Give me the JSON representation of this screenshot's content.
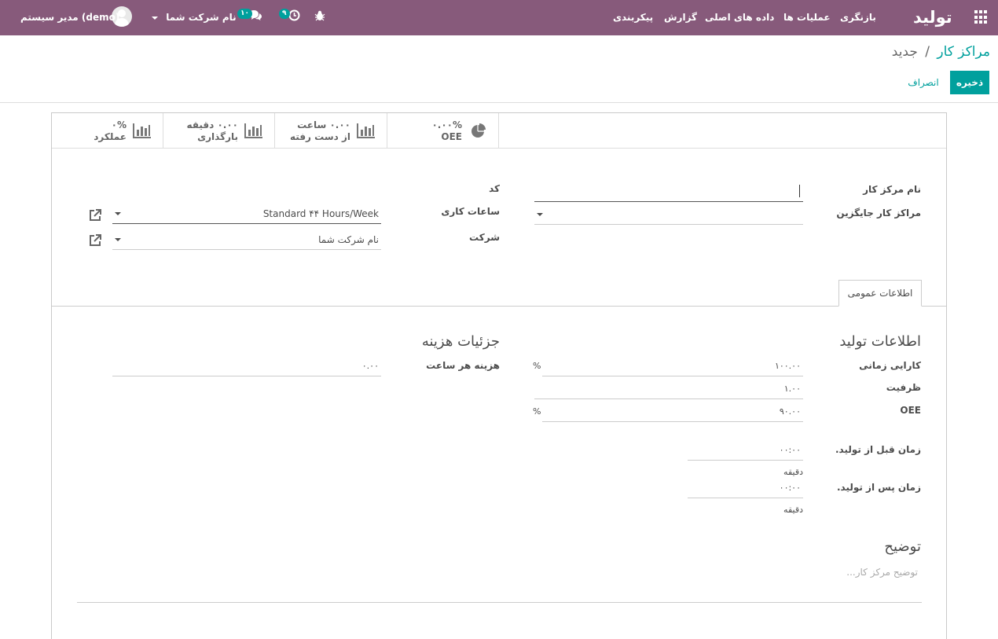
{
  "navbar": {
    "app_name": "تولید",
    "menus": [
      "بازنگری",
      "عملیات ها",
      "داده های اصلی",
      "گزارش",
      "پیکربندی"
    ],
    "user": "مدیر سیستم (demo)",
    "company": "نام شرکت شما",
    "messages_count": "۱۰",
    "activities_count": "۹"
  },
  "breadcrumb": {
    "parent": "مراکز کار",
    "separator": "/",
    "current": "جدید"
  },
  "buttons": {
    "save": "ذخیره",
    "discard": "انصراف"
  },
  "stat_buttons": [
    {
      "value": "۰.۰۰%",
      "label": "OEE",
      "icon": "pie-chart-icon"
    },
    {
      "value": "۰.۰۰ ساعت",
      "label": "از دست رفته",
      "icon": "bar-chart-icon"
    },
    {
      "value": "۰.۰۰ دقیقه",
      "label": "بارگذاری",
      "icon": "bar-chart-icon"
    },
    {
      "value": "۰%",
      "label": "عملکرد",
      "icon": "bar-chart-icon"
    }
  ],
  "form": {
    "name_label": "نام مرکز کار",
    "name_value": "",
    "alternative_label": "مراکز کار جایگزین",
    "alternative_value": "",
    "code_label": "کد",
    "working_hours_label": "ساعات کاری",
    "working_hours_value": "Standard ۴۴ Hours/Week",
    "company_label": "شرکت",
    "company_value": "نام شرکت شما"
  },
  "tab": {
    "general": "اطلاعات عمومی"
  },
  "production": {
    "title": "اطلاعات تولید",
    "time_efficiency_label": "کارایی زمانی",
    "time_efficiency_value": "۱۰۰.۰۰",
    "time_efficiency_unit": "%",
    "capacity_label": "ظرفیت",
    "capacity_value": "۱.۰۰",
    "oee_label": "OEE",
    "oee_value": "۹۰.۰۰",
    "oee_unit": "%",
    "time_before_label": "زمان قبل از تولید.",
    "time_before_value": "۰۰:۰۰",
    "time_before_unit": "دقیقه",
    "time_after_label": "زمان پس از تولید.",
    "time_after_value": "۰۰:۰۰",
    "time_after_unit": "دقیقه"
  },
  "costing": {
    "title": "جزئیات هزینه",
    "cost_per_hour_label": "هزینه هر ساعت",
    "cost_per_hour_value": "۰.۰۰"
  },
  "description": {
    "title": "توضیح",
    "placeholder": "توضیح مرکز کار..."
  }
}
